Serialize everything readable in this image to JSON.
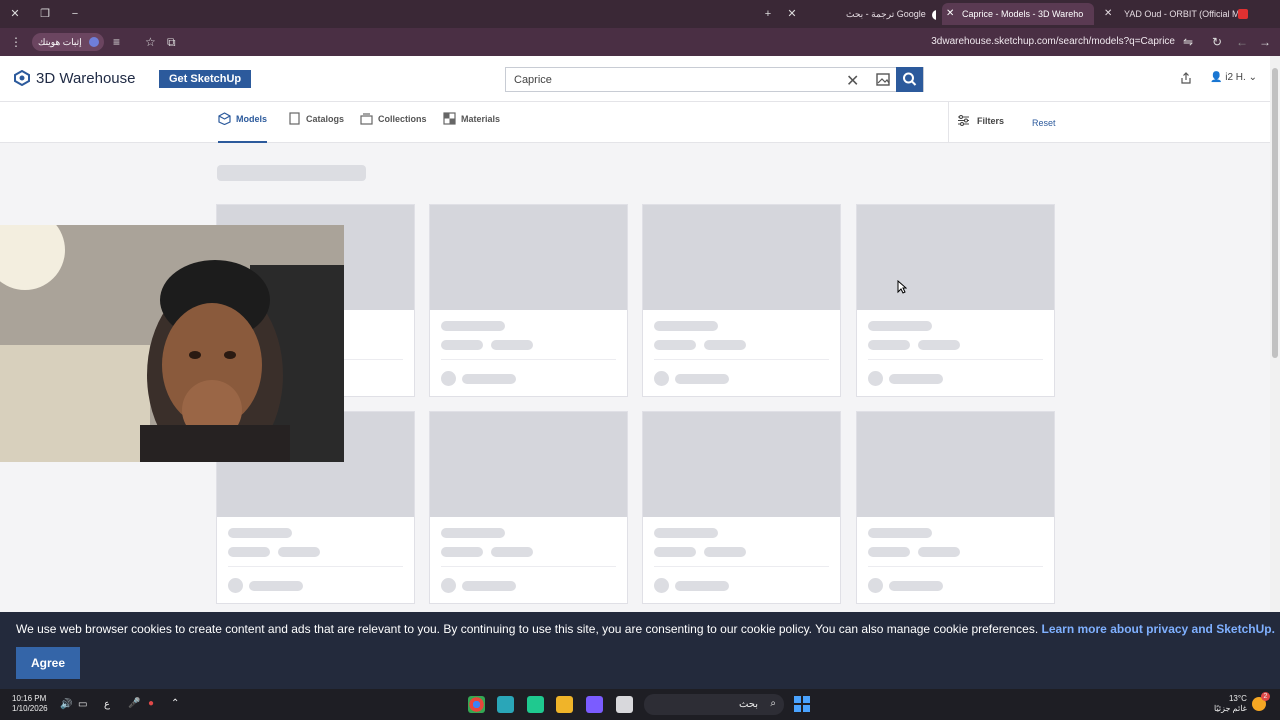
{
  "browser": {
    "tabs": [
      {
        "title": "ترجمة - بحث Google",
        "active": false
      },
      {
        "title": "Caprice - Models - 3D Wareho",
        "active": true
      },
      {
        "title": "YAD Oud - ORBIT (Official M",
        "active": false
      }
    ],
    "pill_label": "إثبات هويتك",
    "url": "3dwarehouse.sketchup.com/search/models?q=Caprice"
  },
  "header": {
    "logo_text": "3D Warehouse",
    "get_sketchup": "Get SketchUp",
    "search_value": "Caprice",
    "user_label": "i2 H."
  },
  "nav": {
    "tabs": [
      "Models",
      "Catalogs",
      "Collections",
      "Materials"
    ],
    "active_tab": "Models",
    "filters": "Filters",
    "reset": "Reset"
  },
  "cookie": {
    "message": "We use web browser cookies to create content and ads that are relevant to you. By continuing to use this site, you are consenting to our cookie policy. You can also manage cookie preferences. ",
    "link": "Learn more about privacy and SketchUp.",
    "agree": "Agree"
  },
  "taskbar": {
    "time": "10:16 PM",
    "date": "1/10/2026",
    "search_label": "بحث",
    "temperature": "13°C",
    "weather": "غائم جزئيًا",
    "notification_count": "2",
    "lang": "ع"
  },
  "colors": {
    "brand_blue": "#2c5a9c",
    "skeleton": "#dcdde2",
    "cookie_bg": "#232a3c"
  }
}
